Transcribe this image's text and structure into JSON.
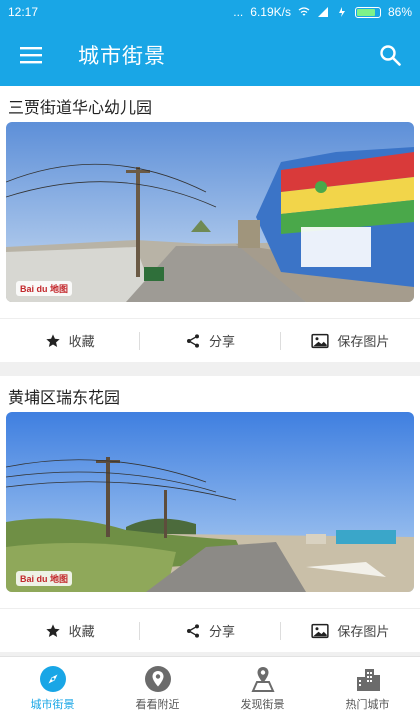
{
  "status_bar": {
    "time": "12:17",
    "dots": "...",
    "network_speed": "6.19K/s",
    "battery": "86%",
    "battery_level": 0.86
  },
  "app_bar": {
    "title": "城市街景",
    "menu_icon": "menu-icon",
    "search_icon": "search-icon"
  },
  "cards": [
    {
      "title": "三贾街道华心幼儿园",
      "watermark": "Bai du 地图",
      "actions": [
        {
          "icon": "star-icon",
          "label": "收藏"
        },
        {
          "icon": "share-icon",
          "label": "分享"
        },
        {
          "icon": "image-icon",
          "label": "保存图片"
        }
      ]
    },
    {
      "title": "黄埔区瑞东花园",
      "watermark": "Bai du 地图",
      "actions": [
        {
          "icon": "star-icon",
          "label": "收藏"
        },
        {
          "icon": "share-icon",
          "label": "分享"
        },
        {
          "icon": "image-icon",
          "label": "保存图片"
        }
      ]
    }
  ],
  "tabs": [
    {
      "label": "城市街景",
      "icon": "compass-icon",
      "active": true
    },
    {
      "label": "看看附近",
      "icon": "location-pin-icon",
      "active": false
    },
    {
      "label": "发现街景",
      "icon": "map-pin-icon",
      "active": false
    },
    {
      "label": "热门城市",
      "icon": "city-buildings-icon",
      "active": false
    }
  ],
  "colors": {
    "primary": "#19a6e6",
    "active_tab": "#19a6e6",
    "inactive_tab": "#555555"
  }
}
